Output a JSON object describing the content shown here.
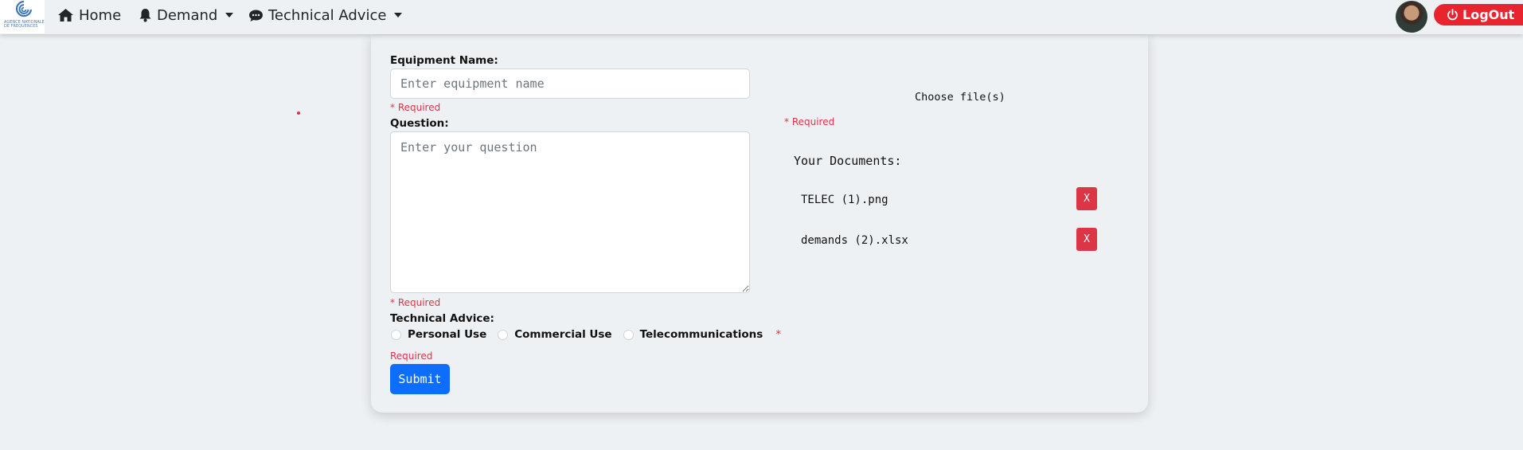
{
  "navbar": {
    "logo_text": "AGENCE NATIONALE DE FREQUENCES",
    "home_label": "Home",
    "demand_label": "Demand",
    "technical_advice_label": "Technical Advice",
    "logout_label": "LogOut"
  },
  "form": {
    "equipment_label": "Equipment Name:",
    "equipment_placeholder": "Enter equipment name",
    "equipment_required": "* Required",
    "question_label": "Question:",
    "question_placeholder": "Enter your question",
    "question_required": "* Required",
    "advice_label": "Technical Advice:",
    "advice_options": [
      "Personal Use",
      "Commercial Use",
      "Telecommunications"
    ],
    "advice_required_star": "*",
    "advice_required": "Required",
    "submit_label": "Submit"
  },
  "files": {
    "choose_label": "Choose file(s)",
    "required": "* Required",
    "documents_title": "Your Documents:",
    "documents": [
      {
        "name": "TELEC (1).png",
        "delete_label": "X"
      },
      {
        "name": "demands (2).xlsx",
        "delete_label": "X"
      }
    ]
  },
  "colors": {
    "primary": "#0d6efd",
    "danger": "#dc3545",
    "logout": "#e8242f"
  }
}
